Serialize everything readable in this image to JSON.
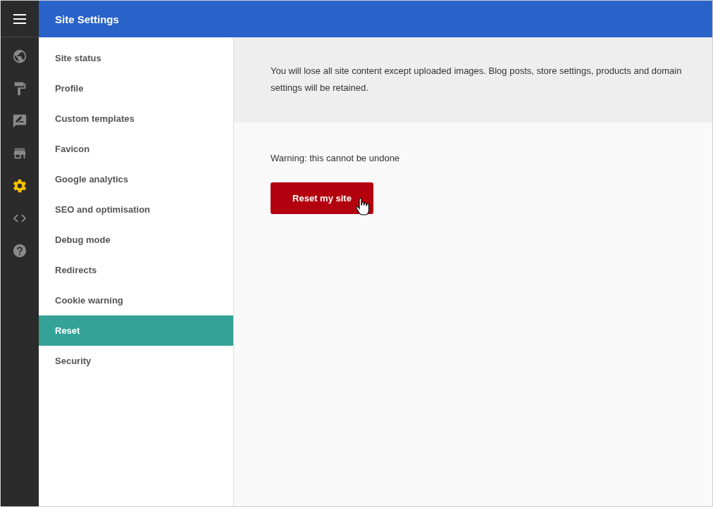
{
  "header": {
    "title": "Site Settings"
  },
  "rail": [
    {
      "kind": "globe",
      "selected": false
    },
    {
      "kind": "roller",
      "selected": false
    },
    {
      "kind": "edit",
      "selected": false
    },
    {
      "kind": "store",
      "selected": false
    },
    {
      "kind": "gear",
      "selected": true
    },
    {
      "kind": "code",
      "selected": false
    },
    {
      "kind": "help",
      "selected": false
    }
  ],
  "sidebar": {
    "items": [
      {
        "label": "Site status",
        "selected": false
      },
      {
        "label": "Profile",
        "selected": false
      },
      {
        "label": "Custom templates",
        "selected": false
      },
      {
        "label": "Favicon",
        "selected": false
      },
      {
        "label": "Google analytics",
        "selected": false
      },
      {
        "label": "SEO and optimisation",
        "selected": false
      },
      {
        "label": "Debug mode",
        "selected": false
      },
      {
        "label": "Redirects",
        "selected": false
      },
      {
        "label": "Cookie warning",
        "selected": false
      },
      {
        "label": "Reset",
        "selected": true
      },
      {
        "label": "Security",
        "selected": false
      }
    ]
  },
  "content": {
    "notice": "You will lose all site content except uploaded images. Blog posts, store settings, products and domain settings will be retained.",
    "warning": "Warning: this cannot be undone",
    "button": "Reset my site"
  }
}
